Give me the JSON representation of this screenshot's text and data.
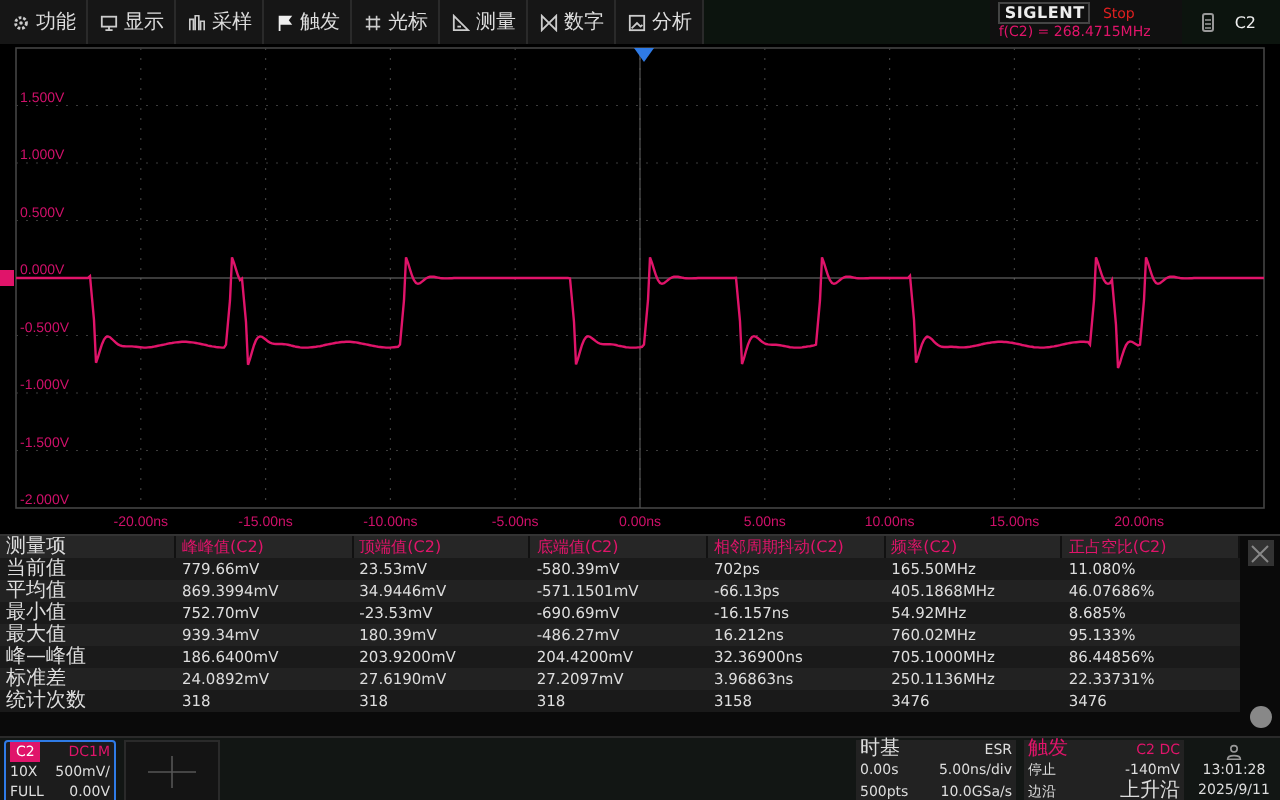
{
  "menu": [
    {
      "label": "功能"
    },
    {
      "label": "显示"
    },
    {
      "label": "采样"
    },
    {
      "label": "触发"
    },
    {
      "label": "光标"
    },
    {
      "label": "测量"
    },
    {
      "label": "数字"
    },
    {
      "label": "分析"
    }
  ],
  "status": {
    "brand": "SIGLENT",
    "run_state": "Stop",
    "frequency": "f(C2) = 268.4715MHz",
    "channel": "C2"
  },
  "plot": {
    "y_labels": [
      "1.500V",
      "1.000V",
      "0.500V",
      "0.000V",
      "-0.500V",
      "-1.000V",
      "-1.500V",
      "-2.000V"
    ],
    "x_labels": [
      "-20.00ns",
      "-15.00ns",
      "-10.00ns",
      "-5.00ns",
      "0.00ns",
      "5.00ns",
      "10.00ns",
      "15.00ns",
      "20.00ns"
    ]
  },
  "measurements": {
    "columns": [
      "测量项",
      "峰峰值(C2)",
      "顶端值(C2)",
      "底端值(C2)",
      "相邻周期抖动(C2)",
      "频率(C2)",
      "正占空比(C2)"
    ],
    "rows": [
      [
        "当前值",
        "779.66mV",
        "23.53mV",
        "-580.39mV",
        "702ps",
        "165.50MHz",
        "11.080%"
      ],
      [
        "平均值",
        "869.3994mV",
        "34.9446mV",
        "-571.1501mV",
        "-66.13ps",
        "405.1868MHz",
        "46.07686%"
      ],
      [
        "最小值",
        "752.70mV",
        "-23.53mV",
        "-690.69mV",
        "-16.157ns",
        "54.92MHz",
        "8.685%"
      ],
      [
        "最大值",
        "939.34mV",
        "180.39mV",
        "-486.27mV",
        "16.212ns",
        "760.02MHz",
        "95.133%"
      ],
      [
        "峰—峰值",
        "186.6400mV",
        "203.9200mV",
        "204.4200mV",
        "32.36900ns",
        "705.1000MHz",
        "86.44856%"
      ],
      [
        "标准差",
        "24.0892mV",
        "27.6190mV",
        "27.2097mV",
        "3.96863ns",
        "250.1136MHz",
        "22.33731%"
      ],
      [
        "统计次数",
        "318",
        "318",
        "318",
        "3158",
        "3476",
        "3476"
      ]
    ]
  },
  "channel": {
    "name": "C2",
    "coupling": "DC1M",
    "probe": "10X",
    "scale": "500mV/",
    "bandwidth": "FULL",
    "offset": "0.00V"
  },
  "timebase": {
    "title": "时基",
    "mode": "ESR",
    "delay": "0.00s",
    "scale": "5.00ns/div",
    "points": "500pts",
    "rate": "10.0GSa/s"
  },
  "trigger": {
    "title": "触发",
    "source": "C2 DC",
    "state": "停止",
    "level": "-140mV",
    "type_label": "边沿",
    "slope": "上升沿"
  },
  "clock": {
    "time": "13:01:28",
    "date": "2025/9/11"
  }
}
